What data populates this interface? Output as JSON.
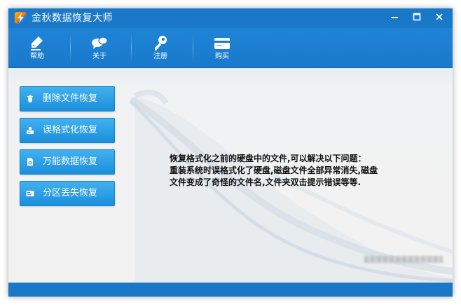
{
  "window": {
    "title": "金秋数据恢复大师",
    "colors": {
      "titlebar": "#1a78c8",
      "button": "#2a9be6",
      "content_bg": "#f1f2f2"
    }
  },
  "titlebar_controls": {
    "minimize": "minimize-icon",
    "maximize": "maximize-icon",
    "close": "close-icon"
  },
  "toolbar": {
    "items": [
      {
        "label": "帮助",
        "icon": "pen-icon"
      },
      {
        "label": "关于",
        "icon": "chat-bubbles-icon"
      },
      {
        "label": "注册",
        "icon": "key-icon"
      },
      {
        "label": "购买",
        "icon": "card-icon"
      }
    ]
  },
  "sidebar": {
    "buttons": [
      {
        "label": "删除文件恢复",
        "icon": "trash-icon"
      },
      {
        "label": "误格式化恢复",
        "icon": "format-icon"
      },
      {
        "label": "万能数据恢复",
        "icon": "document-icon"
      },
      {
        "label": "分区丢失恢复",
        "icon": "partition-icon"
      }
    ]
  },
  "main": {
    "description": [
      "恢复格式化之前的硬盘中的文件,可以解决以下问题：",
      "重装系统时误格式化了硬盘,磁盘文件全部异常消失,磁盘",
      "文件变成了奇怪的文件名,文件夹双击提示错误等等."
    ]
  }
}
